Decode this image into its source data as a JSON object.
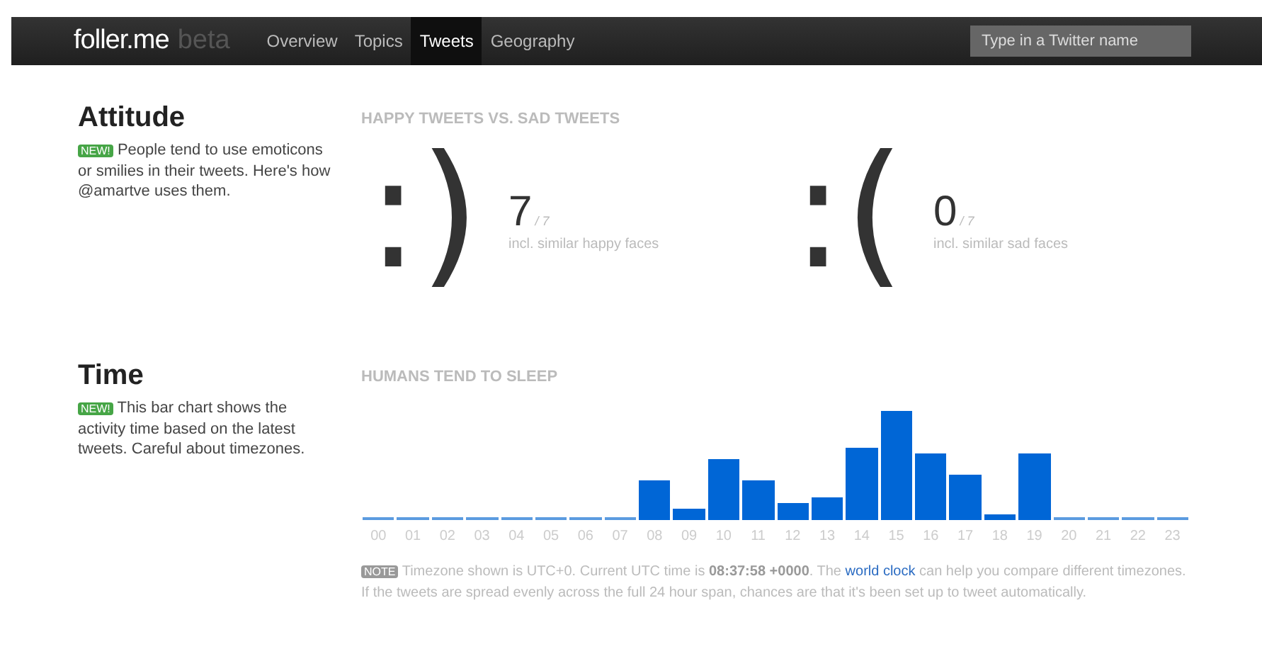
{
  "nav": {
    "logo": "foller.me",
    "logo_tag": "beta",
    "items": [
      {
        "label": "Overview",
        "selected": false
      },
      {
        "label": "Topics",
        "selected": false
      },
      {
        "label": "Tweets",
        "selected": true
      },
      {
        "label": "Geography",
        "selected": false
      }
    ],
    "search": {
      "placeholder": "Type in a Twitter name"
    }
  },
  "attitude": {
    "title": "Attitude",
    "badge": "NEW!",
    "description": "People tend to use emoticons or smilies in their tweets. Here's how @amartve uses them.",
    "heading": "HAPPY TWEETS VS. SAD TWEETS",
    "faces": [
      {
        "face": ":)",
        "count": "7",
        "total": "/ 7",
        "caption": "incl. similar happy faces"
      },
      {
        "face": ":(",
        "count": "0",
        "total": "/ 7",
        "caption": "incl. similar sad faces"
      }
    ]
  },
  "time": {
    "title": "Time",
    "badge": "NEW!",
    "description": "This bar chart shows the activity time based on the latest tweets. Careful about timezones.",
    "heading": "HUMANS TEND TO SLEEP",
    "hours": [
      "00",
      "01",
      "02",
      "03",
      "04",
      "05",
      "06",
      "07",
      "08",
      "09",
      "10",
      "11",
      "12",
      "13",
      "14",
      "15",
      "16",
      "17",
      "18",
      "19",
      "20",
      "21",
      "22",
      "23"
    ],
    "note_badge": "NOTE",
    "note": "Timezone shown is UTC+0. Current UTC time is **08:37:58 +0000**. The",
    "note_link": "world clock",
    "note_rest": "can help you compare different timezones. If the tweets are spread evenly across the full 24 hour span, chances are that it's been set up to tweet automatically."
  }
}
